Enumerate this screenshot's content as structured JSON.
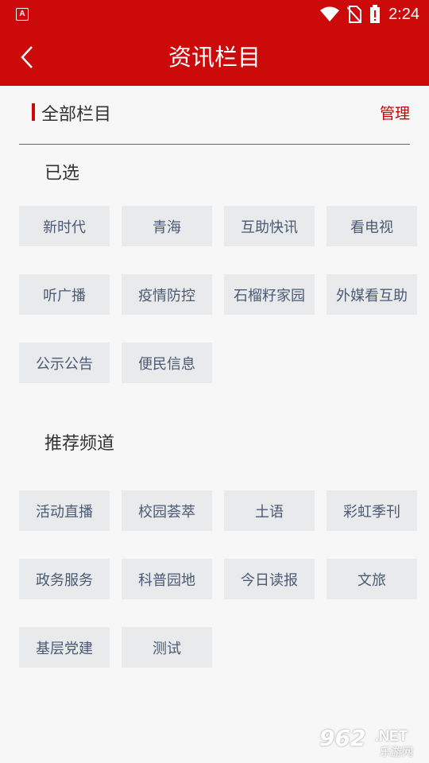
{
  "status_bar": {
    "app_badge": "A",
    "time": "2:24"
  },
  "header": {
    "title": "资讯栏目"
  },
  "all_columns": {
    "title": "全部栏目",
    "manage_label": "管理"
  },
  "selected": {
    "title": "已选",
    "items": [
      "新时代",
      "青海",
      "互助快讯",
      "看电视",
      "听广播",
      "疫情防控",
      "石榴籽家园",
      "外媒看互助",
      "公示公告",
      "便民信息"
    ]
  },
  "recommended": {
    "title": "推荐频道",
    "items": [
      "活动直播",
      "校园荟萃",
      "土语",
      "彩虹季刊",
      "政务服务",
      "科普园地",
      "今日读报",
      "文旅",
      "基层党建",
      "测试"
    ]
  },
  "watermark": {
    "number": "962",
    "domain": ".NET",
    "text": "乐游网"
  },
  "colors": {
    "brand_red": "#cc0a0a",
    "chip_bg": "#e9eaeb",
    "chip_text": "#4a5a75"
  }
}
